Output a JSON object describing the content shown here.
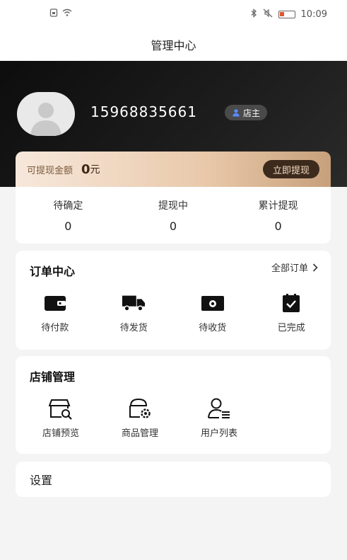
{
  "status_bar": {
    "time": "10:09"
  },
  "nav": {
    "title": "管理中心"
  },
  "profile": {
    "phone": "15968835661",
    "role": "店主"
  },
  "withdraw": {
    "label": "可提现金额",
    "amount": "0",
    "unit": "元",
    "button": "立即提现"
  },
  "stats": [
    {
      "label": "待确定",
      "value": "0"
    },
    {
      "label": "提现中",
      "value": "0"
    },
    {
      "label": "累计提现",
      "value": "0"
    }
  ],
  "orders": {
    "title": "订单中心",
    "all_link": "全部订单",
    "items": [
      {
        "label": "待付款",
        "icon": "wallet-icon"
      },
      {
        "label": "待发货",
        "icon": "truck-icon"
      },
      {
        "label": "待收货",
        "icon": "package-icon"
      },
      {
        "label": "已完成",
        "icon": "clipboard-check-icon"
      }
    ]
  },
  "shop": {
    "title": "店铺管理",
    "items": [
      {
        "label": "店铺预览",
        "icon": "store-search-icon"
      },
      {
        "label": "商品管理",
        "icon": "store-settings-icon"
      },
      {
        "label": "用户列表",
        "icon": "user-list-icon"
      }
    ]
  },
  "settings": {
    "label": "设置"
  }
}
